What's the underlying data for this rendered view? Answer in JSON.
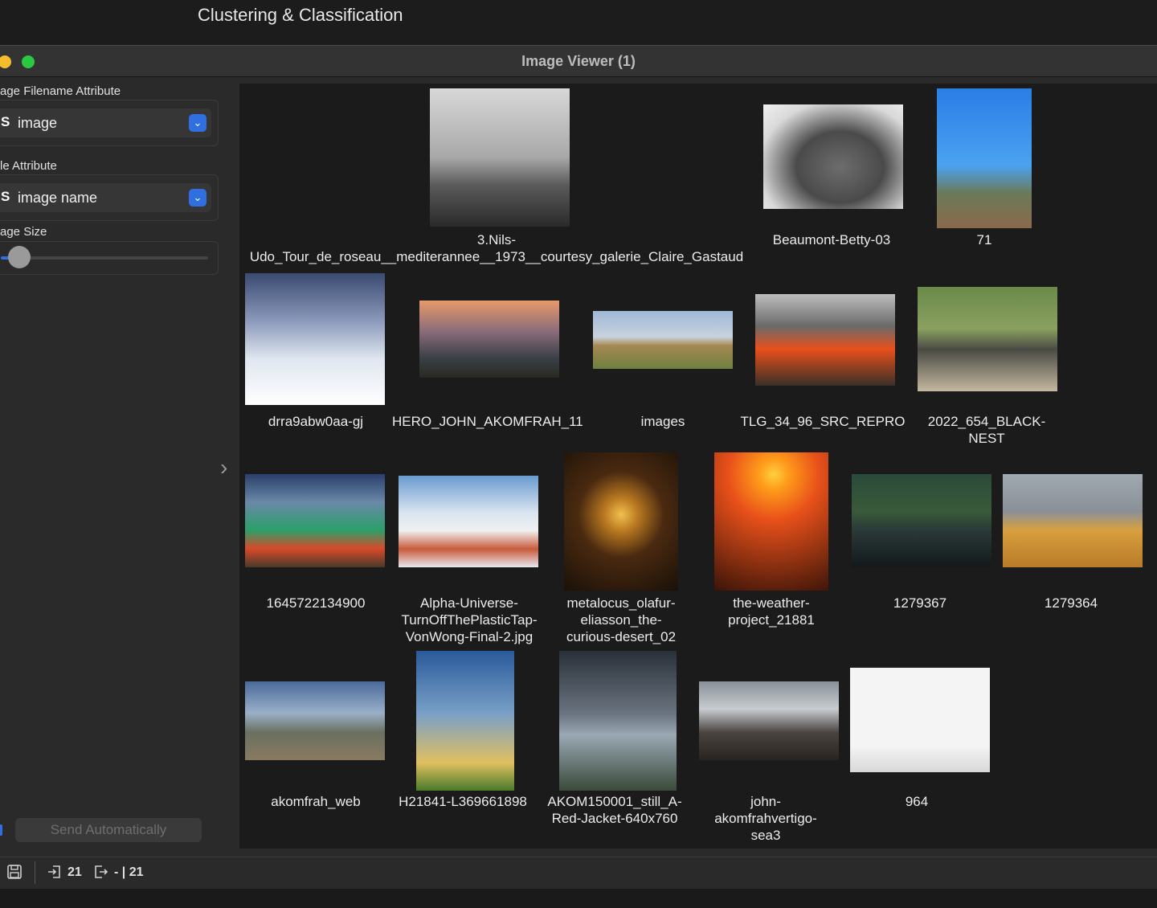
{
  "app": {
    "title": "Clustering & Classification"
  },
  "window": {
    "title": "Image Viewer (1)"
  },
  "sidebar": {
    "filename_label": "age Filename Attribute",
    "filename_type": "S",
    "filename_value": "image",
    "title_label": "le Attribute",
    "title_type": "S",
    "title_value": "image name",
    "size_label": "age Size",
    "size_level": 0.05,
    "send_label": "Send Automatically"
  },
  "images": [
    {
      "caption": "3.Nils-\nUdo_Tour_de_roseau__mediterannee__1973__courtesy_galerie_Claire_Gastaud"
    },
    {
      "caption": "Beaumont-Betty-03"
    },
    {
      "caption": "71"
    },
    {
      "caption": "drra9abw0aa-gj"
    },
    {
      "caption": "HERO_JOHN_AKOMFRAH_11"
    },
    {
      "caption": "images"
    },
    {
      "caption": "TLG_34_96_SRC_REPRO"
    },
    {
      "caption": "2022_654_BLACK-\nNEST"
    },
    {
      "caption": "1645722134900"
    },
    {
      "caption": "Alpha-Universe-\nTurnOffThePlasticTap-\nVonWong-Final-2.jpg"
    },
    {
      "caption": "metalocus_olafur-\neliasson_the-\ncurious-desert_02"
    },
    {
      "caption": "the-weather-\nproject_21881"
    },
    {
      "caption": "1279367"
    },
    {
      "caption": "1279364"
    },
    {
      "caption": "akomfrah_web"
    },
    {
      "caption": "H21841-L369661898"
    },
    {
      "caption": "AKOM150001_still_A-\nRed-Jacket-640x760"
    },
    {
      "caption": "john-\nakomfrahvertigo-\nsea3"
    },
    {
      "caption": "964"
    }
  ],
  "status": {
    "input_count": "21",
    "output_count": "- | 21"
  },
  "colors": {
    "accent": "#2f6fe0",
    "viewer_bg": "#1b1b1b"
  }
}
